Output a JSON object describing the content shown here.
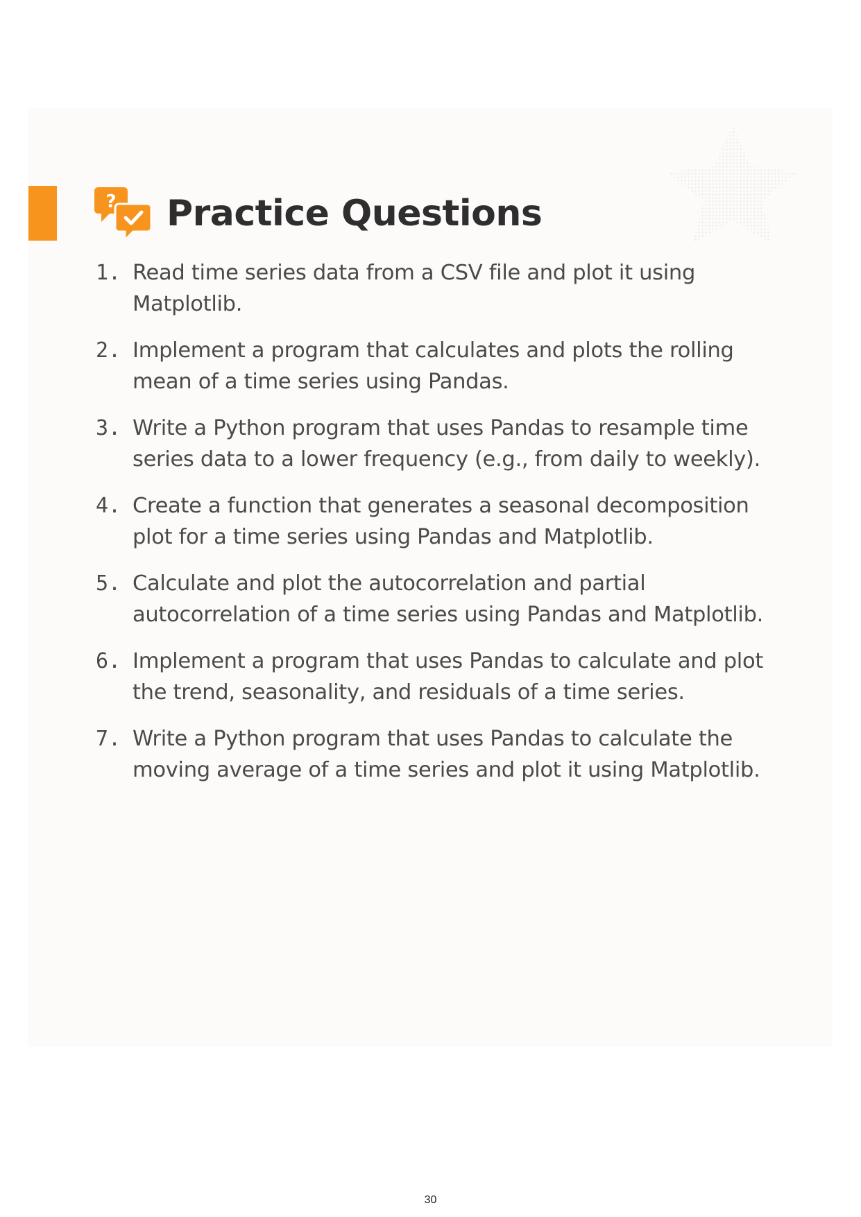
{
  "colors": {
    "accent": "#f7941d",
    "card_background": "#fdfbf9",
    "title": "#2e2e2e",
    "body_text": "#4a4a4a"
  },
  "section": {
    "title": "Practice Questions",
    "icon": "question-answer-chat-icon"
  },
  "questions": [
    {
      "number": "1.",
      "text": "Read time series data from a CSV file and plot it using Matplotlib."
    },
    {
      "number": "2.",
      "text": "Implement a program that calculates and plots the rolling mean of a time series using Pandas."
    },
    {
      "number": "3.",
      "text": "Write a Python program that uses Pandas to resample time series data to a lower frequency (e.g., from daily to weekly)."
    },
    {
      "number": "4.",
      "text": "Create a function that generates a seasonal decomposition plot for a time series using Pandas and Matplotlib."
    },
    {
      "number": "5.",
      "text": "Calculate and plot the autocorrelation and partial autocorrelation of a time series using Pandas and Matplotlib."
    },
    {
      "number": "6.",
      "text": "Implement a program that uses Pandas to calculate and plot the trend, seasonality, and residuals of a time series."
    },
    {
      "number": "7.",
      "text": "Write a Python program that uses Pandas to calculate the moving average of a time series and plot it using Matplotlib."
    }
  ],
  "footer": {
    "page_number": "30"
  }
}
